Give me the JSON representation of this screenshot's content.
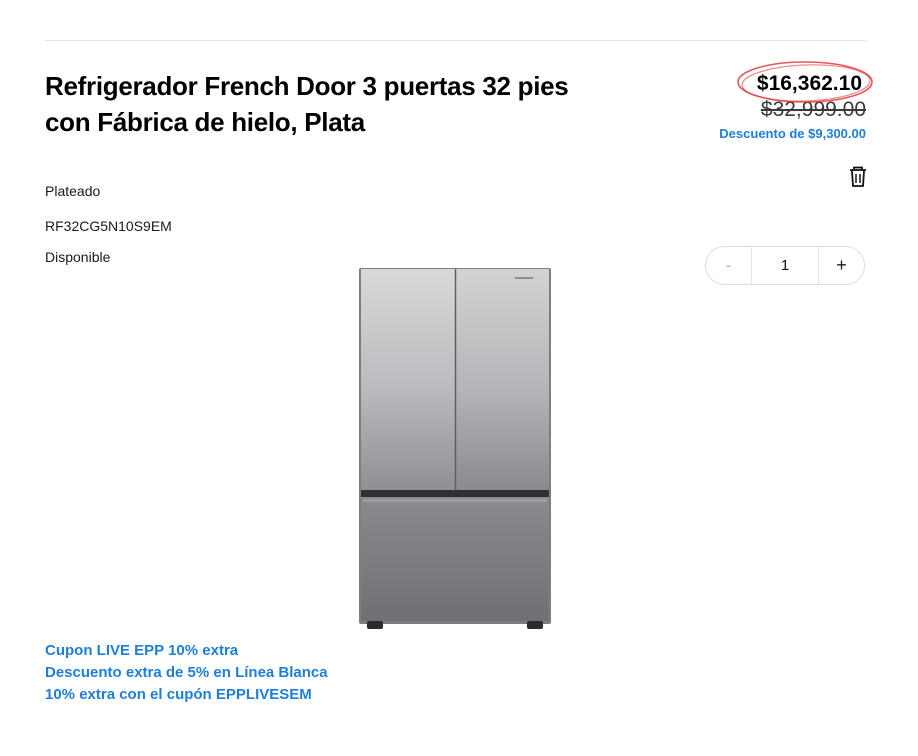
{
  "product": {
    "title": "Refrigerador French Door 3 puertas 32 pies con Fábrica de hielo, Plata",
    "color": "Plateado",
    "sku": "RF32CG5N10S9EM",
    "availability": "Disponible"
  },
  "pricing": {
    "current": "$16,362.10",
    "original": "$32,999.00",
    "discount": "Descuento de $9,300.00"
  },
  "quantity": {
    "minus": "-",
    "value": "1",
    "plus": "+"
  },
  "promotions": [
    "Cupon LIVE EPP 10% extra",
    "Descuento extra de 5% en Línea Blanca",
    "10% extra con el cupón EPPLIVESEM"
  ],
  "icons": {
    "delete": "trash-icon",
    "annotation": "red-circle-annotation"
  },
  "colors": {
    "accent_blue": "#1f7ed6",
    "annotation_red": "#e23b3b"
  }
}
